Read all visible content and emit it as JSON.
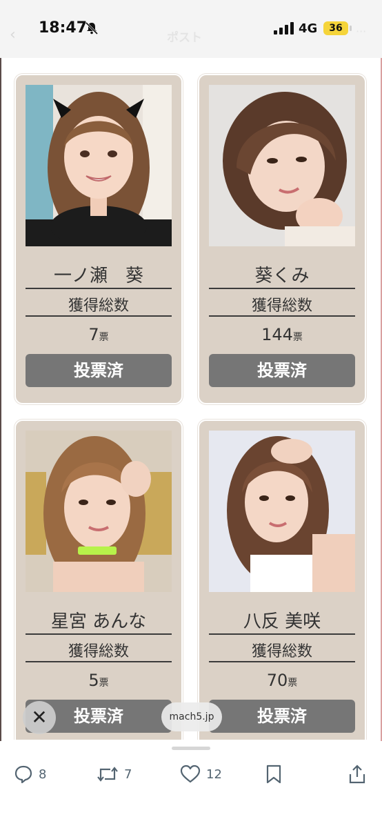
{
  "status_bar": {
    "time": "18:47",
    "network": "4G",
    "battery": "36",
    "back": "‹",
    "faded_title": "ポスト",
    "more": "···"
  },
  "cards": [
    {
      "name": "一ノ瀬　葵",
      "label": "獲得総数",
      "votes": "7",
      "unit": "票",
      "button": "投票済"
    },
    {
      "name": "葵くみ",
      "label": "獲得総数",
      "votes": "144",
      "unit": "票",
      "button": "投票済"
    },
    {
      "name": "星宮 あんな",
      "label": "獲得総数",
      "votes": "5",
      "unit": "票",
      "button": "投票済"
    },
    {
      "name": "八反 美咲",
      "label": "獲得総数",
      "votes": "70",
      "unit": "票",
      "button": "投票済"
    }
  ],
  "overlay": {
    "close_glyph": "✕",
    "domain": "mach5.jp"
  },
  "actions": {
    "replies": "8",
    "reposts": "7",
    "likes": "12"
  },
  "colors": {
    "card_bg": "#dbd1c6",
    "button_bg": "#767676",
    "battery_bg": "#f5d43a",
    "icon_gray": "#536471"
  }
}
